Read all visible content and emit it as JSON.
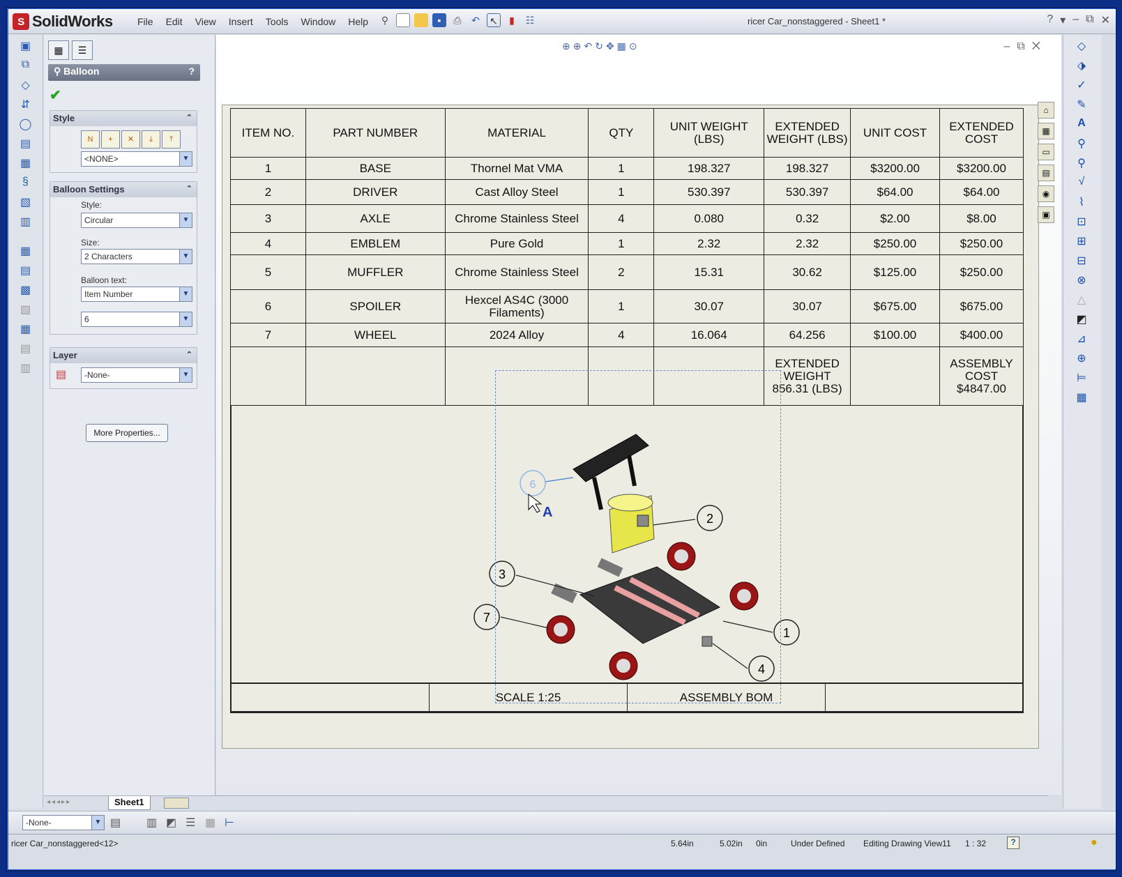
{
  "app": {
    "logo": "SolidWorks",
    "menus": [
      "File",
      "Edit",
      "View",
      "Insert",
      "Tools",
      "Window",
      "Help"
    ],
    "doc_title": "ricer Car_nonstaggered - Sheet1 *",
    "window_controls": [
      "?",
      "▾",
      "–",
      "⧉",
      "✕"
    ]
  },
  "property_manager": {
    "title": "Balloon",
    "help": "?",
    "ok_symbol": "✔",
    "style_group": {
      "title": "Style",
      "value": "<NONE>"
    },
    "balloon_settings": {
      "title": "Balloon Settings",
      "style_label": "Style:",
      "style_value": "Circular",
      "size_label": "Size:",
      "size_value": "2 Characters",
      "text_label": "Balloon text:",
      "text_value": "Item Number",
      "number_value": "6"
    },
    "layer_group": {
      "title": "Layer",
      "value": "-None-"
    },
    "more_properties": "More Properties..."
  },
  "bom": {
    "headers": [
      "ITEM NO.",
      "PART NUMBER",
      "MATERIAL",
      "QTY",
      "UNIT WEIGHT (LBS)",
      "EXTENDED WEIGHT (LBS)",
      "UNIT COST",
      "EXTENDED COST"
    ],
    "rows": [
      [
        "1",
        "BASE",
        "Thornel Mat VMA",
        "1",
        "198.327",
        "198.327",
        "$3200.00",
        "$3200.00"
      ],
      [
        "2",
        "DRIVER",
        "Cast Alloy Steel",
        "1",
        "530.397",
        "530.397",
        "$64.00",
        "$64.00"
      ],
      [
        "3",
        "AXLE",
        "Chrome Stainless Steel",
        "4",
        "0.080",
        "0.32",
        "$2.00",
        "$8.00"
      ],
      [
        "4",
        "EMBLEM",
        "Pure Gold",
        "1",
        "2.32",
        "2.32",
        "$250.00",
        "$250.00"
      ],
      [
        "5",
        "MUFFLER",
        "Chrome Stainless Steel",
        "2",
        "15.31",
        "30.62",
        "$125.00",
        "$250.00"
      ],
      [
        "6",
        "SPOILER",
        "Hexcel AS4C (3000 Filaments)",
        "1",
        "30.07",
        "30.07",
        "$675.00",
        "$675.00"
      ],
      [
        "7",
        "WHEEL",
        "2024 Alloy",
        "4",
        "16.064",
        "64.256",
        "$100.00",
        "$400.00"
      ]
    ],
    "total_weight": "EXTENDED WEIGHT 856.31 (LBS)",
    "total_cost": "ASSEMBLY COST $4847.00"
  },
  "drawing": {
    "balloons": [
      "2",
      "3",
      "7",
      "1",
      "4",
      "6"
    ],
    "scale": "SCALE 1:25",
    "title": "ASSEMBLY BOM"
  },
  "sheet_tab": "Sheet1",
  "layer_bar": {
    "value": "-None-"
  },
  "status": {
    "doc": "ricer Car_nonstaggered<12>",
    "x": "5.64in",
    "y": "5.02in",
    "z": "0in",
    "state": "Under Defined",
    "editing": "Editing Drawing View11",
    "scale": "1 : 32"
  }
}
